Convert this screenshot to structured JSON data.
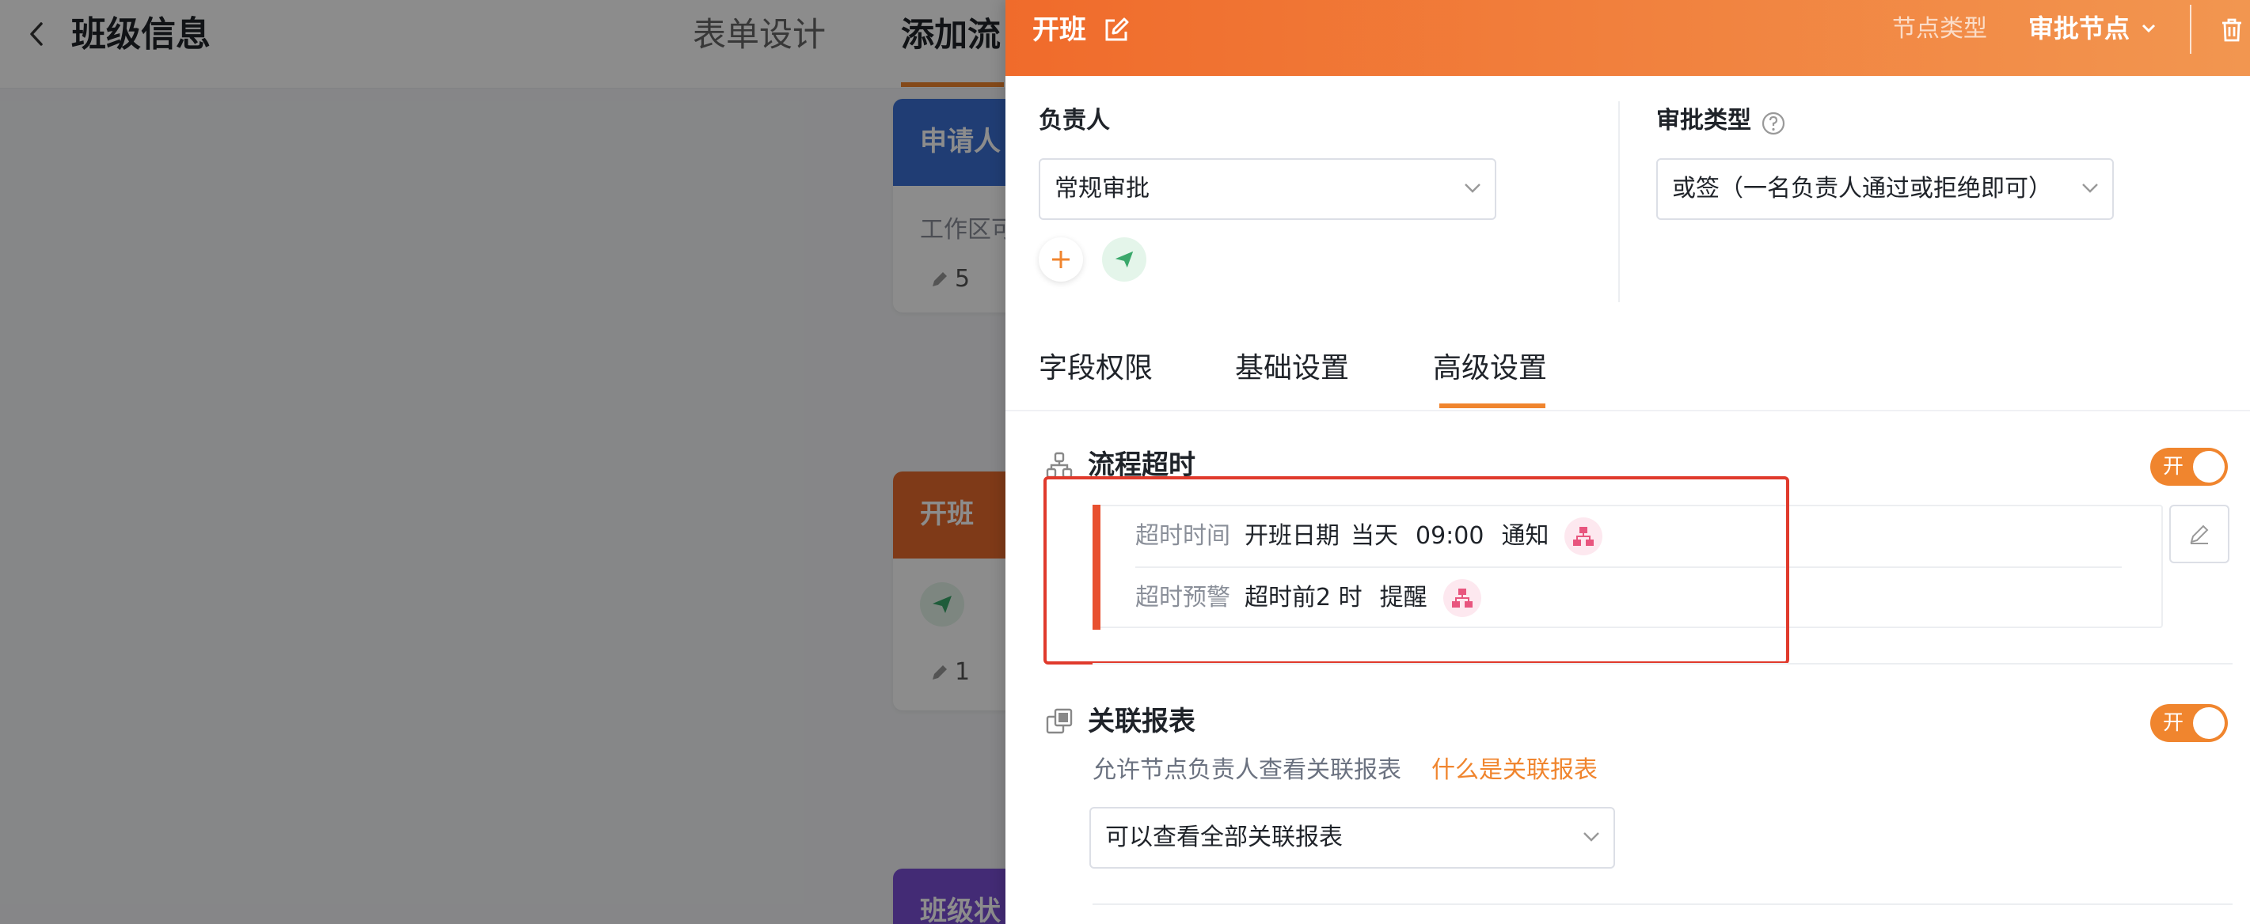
{
  "background": {
    "title": "班级信息",
    "tabs": [
      "表单设计",
      "添加流"
    ],
    "cards": [
      {
        "title": "申请人",
        "body": "工作区可",
        "count": "5"
      },
      {
        "title": "开班",
        "count": "1"
      },
      {
        "title": "班级状"
      }
    ]
  },
  "drawer": {
    "title": "开班",
    "node_type_label": "节点类型",
    "node_type_value": "审批节点",
    "owner": {
      "label": "负责人",
      "value": "常规审批"
    },
    "approval_type": {
      "label": "审批类型",
      "value": "或签（一名负责人通过或拒绝即可）"
    },
    "tabs": [
      "字段权限",
      "基础设置",
      "高级设置"
    ],
    "active_tab": "高级设置",
    "timeout": {
      "title": "流程超时",
      "toggle": "开",
      "row1": {
        "label": "超时时间",
        "values": [
          "开班日期",
          "当天",
          "09:00",
          "通知"
        ]
      },
      "row2": {
        "label": "超时预警",
        "values": [
          "超时前2 时",
          "提醒"
        ]
      }
    },
    "report": {
      "title": "关联报表",
      "toggle": "开",
      "description": "允许节点负责人查看关联报表",
      "link": "什么是关联报表",
      "select_value": "可以查看全部关联报表"
    }
  },
  "colors": {
    "accent": "#f0852e",
    "header_gradient_start": "#f06b2b",
    "header_gradient_end": "#f29650",
    "highlight": "#e03a2c",
    "timeout_bar": "#e8502f"
  }
}
